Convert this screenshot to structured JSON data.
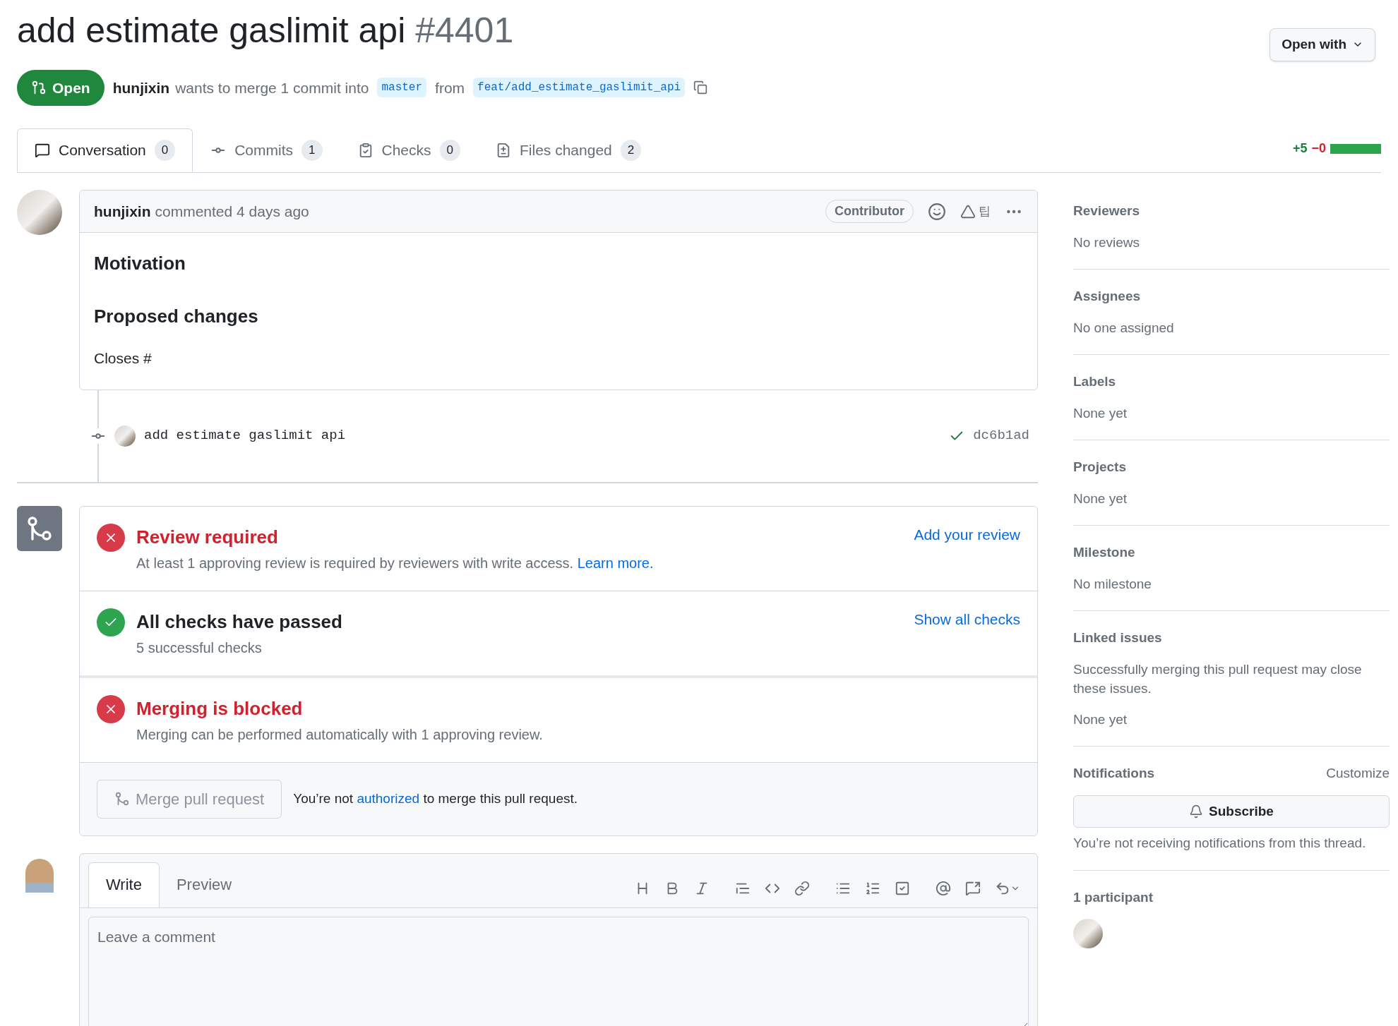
{
  "header": {
    "title": "add estimate gaslimit api",
    "number": "#4401",
    "open_with": "Open with",
    "state": "Open",
    "author": "hunjixin",
    "summary": "wants to merge 1 commit into",
    "base": "master",
    "from": "from",
    "head": "feat/add_estimate_gaslimit_api"
  },
  "tabs": [
    {
      "kind": "conversation",
      "label": "Conversation",
      "count": "0",
      "selected": true
    },
    {
      "kind": "commits",
      "label": "Commits",
      "count": "1",
      "selected": false
    },
    {
      "kind": "checks",
      "label": "Checks",
      "count": "0",
      "selected": false
    },
    {
      "kind": "files",
      "label": "Files changed",
      "count": "2",
      "selected": false
    }
  ],
  "diffstat": {
    "added": "+5",
    "removed": "−0"
  },
  "comment": {
    "author": "hunjixin",
    "meta": "commented 4 days ago",
    "role": "Contributor",
    "extension_text": "팁",
    "heading_1": "Motivation",
    "heading_2": "Proposed changes",
    "body": "Closes #"
  },
  "commit": {
    "message": "add estimate gaslimit api",
    "sha": "dc6b1ad"
  },
  "merge_items": [
    {
      "kind": "fail",
      "title": "Review required",
      "text": "At least 1 approving review is required by reviewers with write access.",
      "link": "Learn more.",
      "action": "Add your review"
    },
    {
      "kind": "pass",
      "title": "All checks have passed",
      "text": "5 successful checks",
      "action": "Show all checks"
    },
    {
      "kind": "fail",
      "title": "Merging is blocked",
      "text": "Merging can be performed automatically with 1 approving review."
    }
  ],
  "merge_button": {
    "label": "Merge pull request",
    "disabled": true
  },
  "merge_note": {
    "before": "You’re not",
    "link": "authorized",
    "after": "to merge this pull request."
  },
  "editor": {
    "tabs": [
      {
        "label": "Write",
        "selected": true
      },
      {
        "label": "Preview",
        "selected": false
      }
    ],
    "placeholder": "Leave a comment"
  },
  "sidebar": [
    {
      "heading": "Reviewers",
      "lines": [
        "No reviews"
      ]
    },
    {
      "heading": "Assignees",
      "lines": [
        "No one assigned"
      ]
    },
    {
      "heading": "Labels",
      "lines": [
        "None yet"
      ]
    },
    {
      "heading": "Projects",
      "lines": [
        "None yet"
      ]
    },
    {
      "heading": "Milestone",
      "lines": [
        "No milestone"
      ]
    },
    {
      "heading": "Linked issues",
      "lines": [
        "Successfully merging this pull request may close these issues.",
        "None yet"
      ]
    }
  ],
  "notifications": {
    "heading": "Notifications",
    "customize": "Customize",
    "button": "Subscribe",
    "note": "You’re not receiving notifications from this thread."
  },
  "participants": {
    "heading": "1 participant"
  }
}
